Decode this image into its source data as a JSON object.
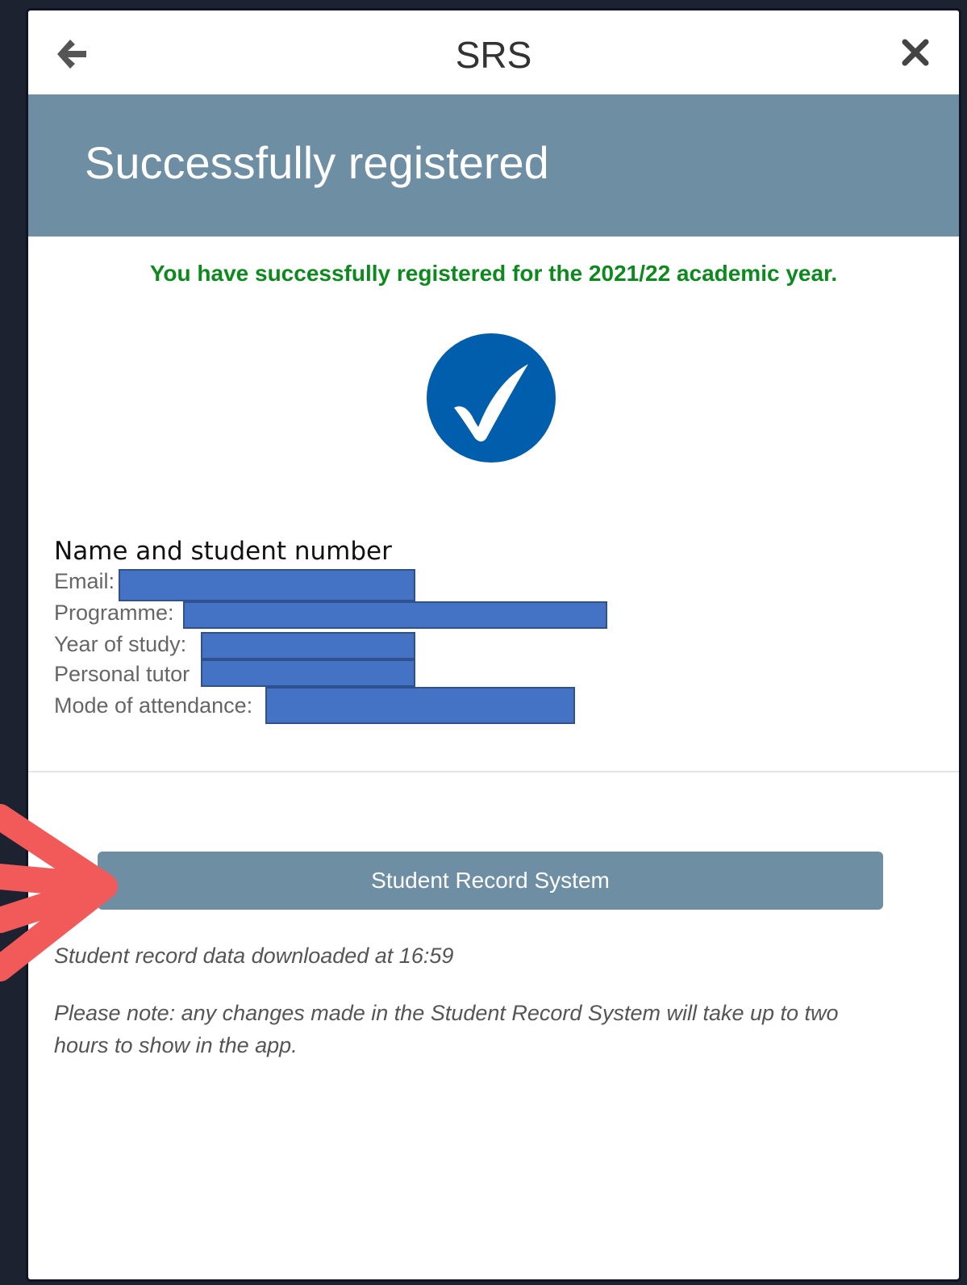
{
  "header": {
    "title": "SRS"
  },
  "banner": {
    "title": "Successfully registered"
  },
  "status": {
    "message": "You have successfully registered for the 2021/22 academic year."
  },
  "student": {
    "name_line": "Name and student number",
    "email_label": "Email:",
    "programme_label": "Programme:",
    "year_label": "Year of study:",
    "tutor_label": "Personal tutor",
    "mode_label": "Mode of attendance:"
  },
  "actions": {
    "srs_button_label": "Student Record System"
  },
  "footer": {
    "download_note": "Student record data downloaded at 16:59",
    "please_note": "Please note: any changes made in the Student Record System will take up to two hours to show in the app."
  },
  "colors": {
    "banner": "#6e8ea4",
    "success_text": "#0d8a1d",
    "check_circle": "#005eac",
    "redaction": "#4472c4",
    "annotation_arrow": "#f25a5a"
  },
  "icons": {
    "back": "arrow-left-icon",
    "close": "close-icon",
    "success": "checkmark-circle-icon"
  }
}
